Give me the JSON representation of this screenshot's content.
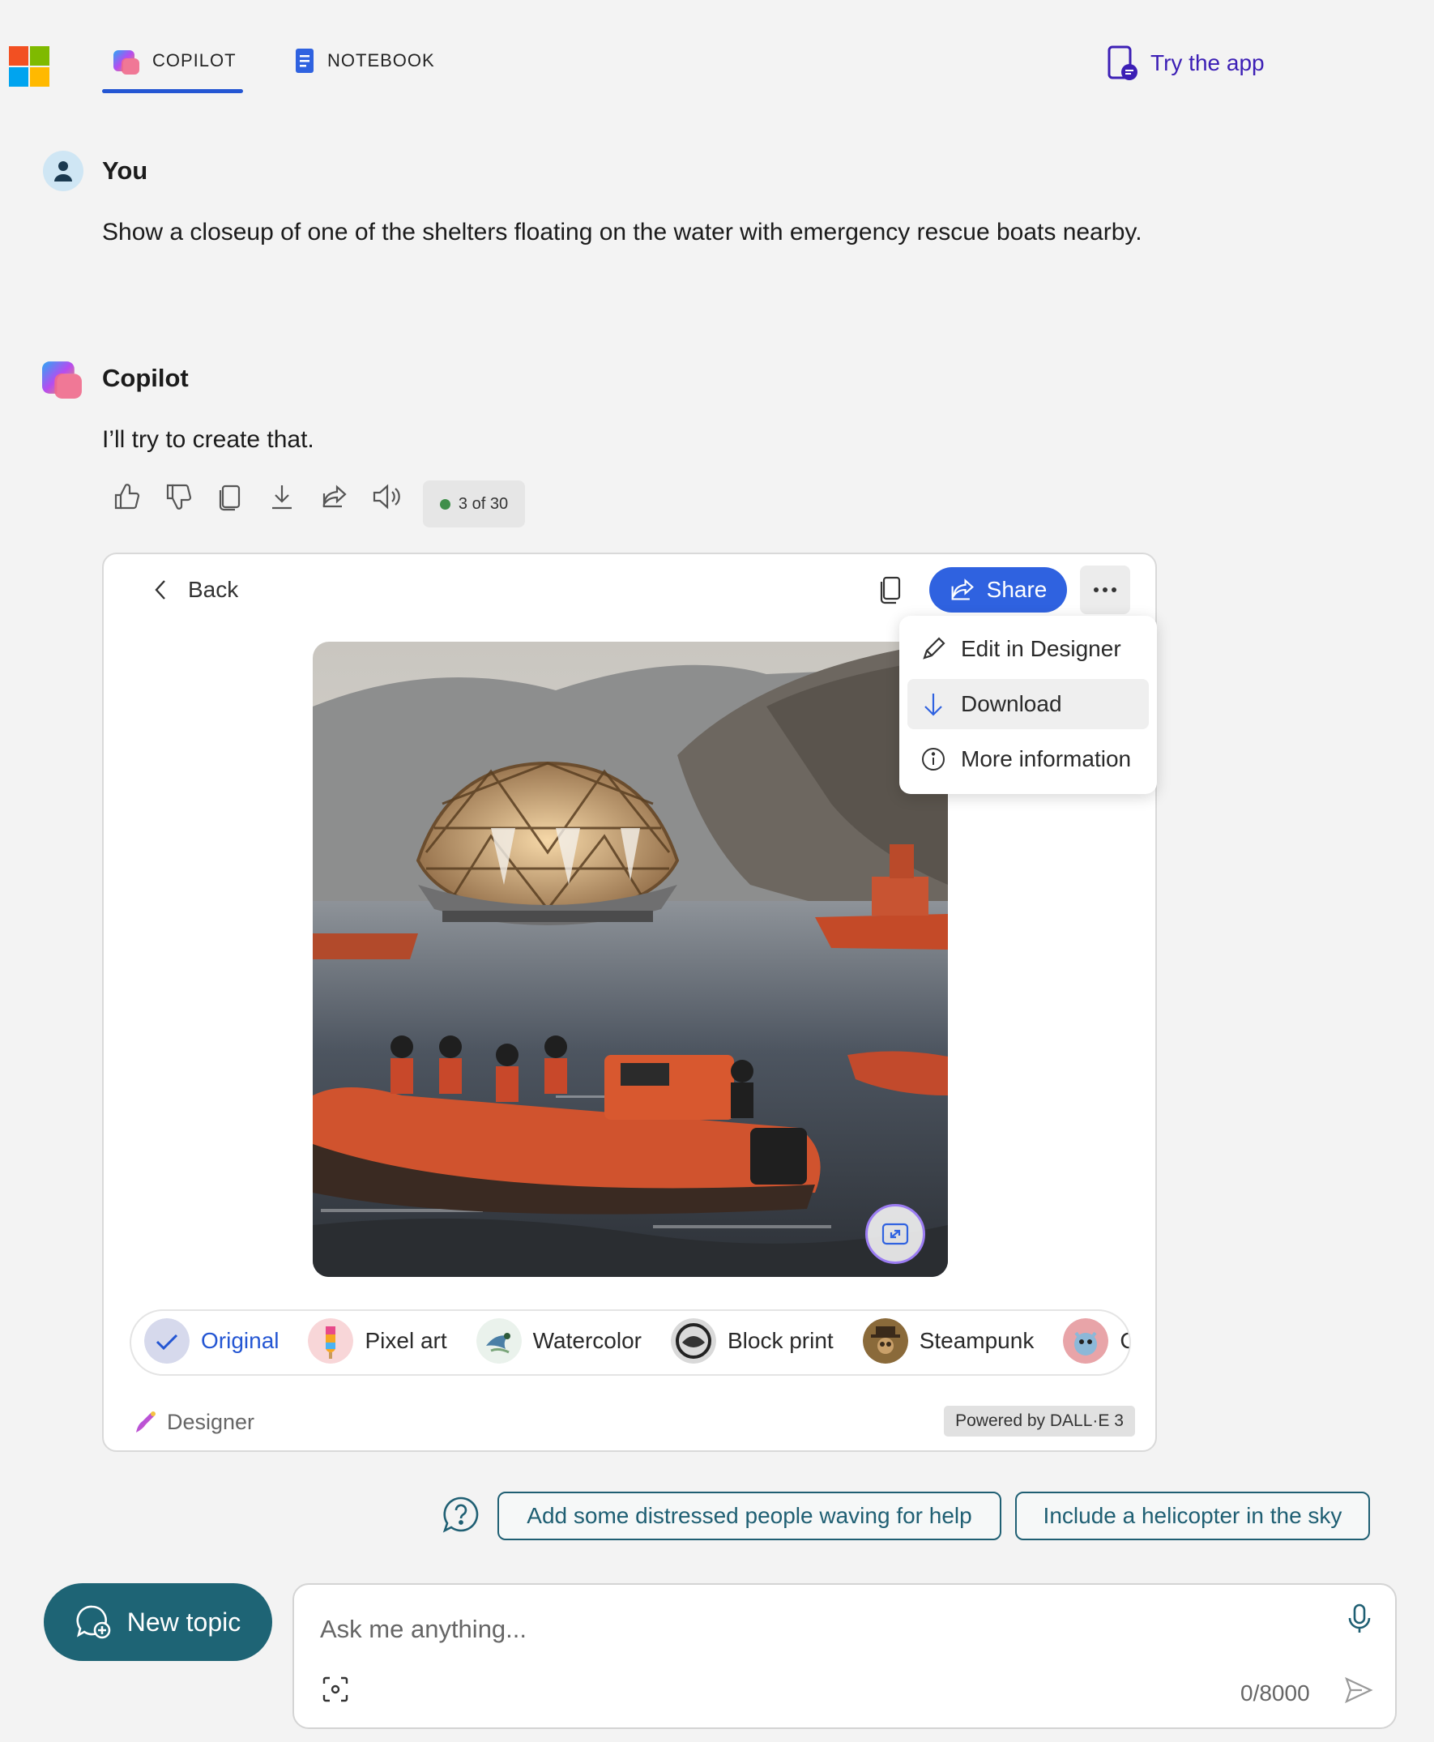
{
  "header": {
    "tabs": [
      {
        "label": "COPILOT",
        "icon": "copilot-icon",
        "selected": true
      },
      {
        "label": "NOTEBOOK",
        "icon": "notebook-icon",
        "selected": false
      }
    ],
    "try_app_label": "Try the app"
  },
  "conversation": {
    "user": {
      "sender": "You",
      "text": "Show a closeup of one of the shelters floating on the water with emergency rescue boats nearby."
    },
    "assistant": {
      "sender": "Copilot",
      "text": "I’ll try to create that.",
      "counter": "3 of 30",
      "actions": [
        "thumbs-up-icon",
        "thumbs-down-icon",
        "copy-icon",
        "download-icon",
        "share-icon",
        "speaker-icon"
      ]
    }
  },
  "image_card": {
    "back_label": "Back",
    "share_label": "Share",
    "menu": {
      "items": [
        {
          "label": "Edit in Designer",
          "icon": "pencil-icon"
        },
        {
          "label": "Download",
          "icon": "download-arrow-icon",
          "highlighted": true
        },
        {
          "label": "More information",
          "icon": "info-icon"
        }
      ]
    },
    "styles": [
      {
        "label": "Original",
        "selected": true
      },
      {
        "label": "Pixel art",
        "selected": false
      },
      {
        "label": "Watercolor",
        "selected": false
      },
      {
        "label": "Block print",
        "selected": false
      },
      {
        "label": "Steampunk",
        "selected": false
      },
      {
        "label": "Cla",
        "selected": false
      }
    ],
    "footer": {
      "designer_label": "Designer",
      "powered_label": "Powered by DALL·E 3"
    }
  },
  "suggestions": [
    "Add some distressed people waving for help",
    "Include a helicopter in the sky"
  ],
  "composer": {
    "new_topic_label": "New topic",
    "placeholder": "Ask me anything...",
    "char_count": "0/8000"
  },
  "colors": {
    "accent_blue": "#2f62e0",
    "teal": "#1e6475",
    "try_app_purple": "#3c1fb5"
  }
}
